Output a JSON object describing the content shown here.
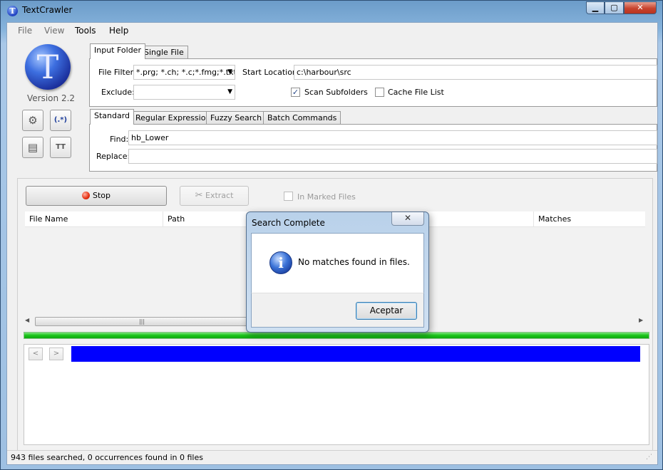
{
  "window": {
    "title": "TextCrawler",
    "min_label": "▁",
    "max_label": "▢",
    "close_label": "✕"
  },
  "menu": [
    "File",
    "View",
    "Tools",
    "Help"
  ],
  "logo": {
    "letter": "T",
    "version": "Version 2.2"
  },
  "toolbar": {
    "settings_icon": "⚙",
    "regex_icon": "(.*)",
    "file_icon": "▤",
    "text_icon": "TT"
  },
  "folder_tabs": {
    "input_folder": "Input Folder",
    "single_file": "Single File"
  },
  "filters": {
    "file_filter_label": "File Filter:",
    "file_filter_value": "*.prg; *.ch; *.c;*.fmg;*.txt",
    "exclude_label": "Exclude:",
    "exclude_value": "",
    "start_location_label": "Start Location:",
    "start_location_value": "c:\\harbour\\src",
    "scan_subfolders_label": "Scan Subfolders",
    "scan_subfolders_checked": true,
    "cache_file_list_label": "Cache File List",
    "cache_file_list_checked": false
  },
  "search_tabs": {
    "standard": "Standard",
    "regex": "Regular Expression",
    "fuzzy": "Fuzzy Search",
    "batch": "Batch Commands"
  },
  "search": {
    "find_label": "Find:",
    "find_value": "hb_Lower",
    "replace_label": "Replace:",
    "replace_value": ""
  },
  "actions": {
    "stop_label": "Stop",
    "extract_label": "Extract",
    "in_marked_files_label": "In Marked Files"
  },
  "results": {
    "columns": {
      "file_name": "File Name",
      "path": "Path",
      "matches": "Matches"
    }
  },
  "preview": {
    "prev_label": "<",
    "next_label": ">"
  },
  "status": {
    "text": "943 files searched, 0 occurrences found in 0 files"
  },
  "dialog": {
    "title": "Search Complete",
    "message": "No matches found in files.",
    "ok_label": "Aceptar",
    "close_label": "✕"
  },
  "progress": {
    "percent": 100,
    "color": "#19c319"
  }
}
